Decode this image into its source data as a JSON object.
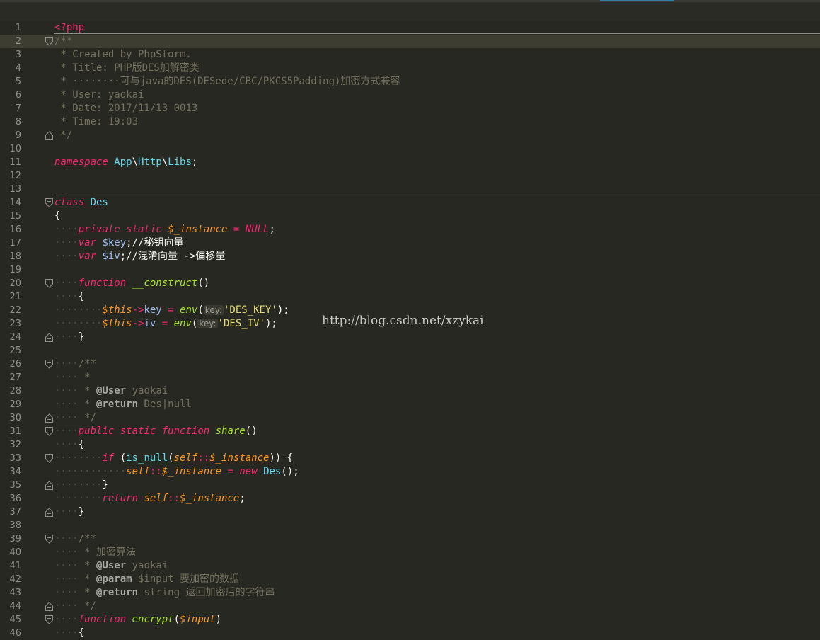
{
  "watermark": "http://blog.csdn.net/xzykai",
  "lines": [
    {
      "n": "1",
      "segs": [
        [
          "php-open",
          "<?php"
        ]
      ]
    },
    {
      "n": "2",
      "fold": "open",
      "current": true,
      "segs": [
        [
          "cmt",
          "/**"
        ]
      ]
    },
    {
      "n": "3",
      "segs": [
        [
          "cmt",
          " * Created by PhpStorm."
        ]
      ]
    },
    {
      "n": "4",
      "segs": [
        [
          "cmt",
          " * Title: PHP版DES加解密类"
        ]
      ]
    },
    {
      "n": "5",
      "segs": [
        [
          "cmt",
          " * ········可与java的DES(DESede/CBC/PKCS5Padding)加密方式兼容"
        ]
      ]
    },
    {
      "n": "6",
      "segs": [
        [
          "cmt",
          " * User: yaokai"
        ]
      ]
    },
    {
      "n": "7",
      "segs": [
        [
          "cmt",
          " * Date: 2017/11/13 0013"
        ]
      ]
    },
    {
      "n": "8",
      "segs": [
        [
          "cmt",
          " * Time: 19:03"
        ]
      ]
    },
    {
      "n": "9",
      "fold": "close",
      "segs": [
        [
          "cmt",
          " */"
        ]
      ]
    },
    {
      "n": "10",
      "segs": []
    },
    {
      "n": "11",
      "segs": [
        [
          "kw",
          "namespace"
        ],
        [
          "plain",
          " "
        ],
        [
          "cls",
          "App"
        ],
        [
          "plain",
          "\\"
        ],
        [
          "cls",
          "Http"
        ],
        [
          "plain",
          "\\"
        ],
        [
          "cls",
          "Libs"
        ],
        [
          "plain",
          ";"
        ]
      ]
    },
    {
      "n": "12",
      "segs": []
    },
    {
      "n": "13",
      "segs": []
    },
    {
      "n": "14",
      "fold": "open",
      "segs": [
        [
          "kw",
          "class"
        ],
        [
          "plain",
          " "
        ],
        [
          "cls",
          "Des"
        ]
      ]
    },
    {
      "n": "15",
      "segs": [
        [
          "plain",
          "{"
        ]
      ]
    },
    {
      "n": "16",
      "segs": [
        [
          "ws",
          "····"
        ],
        [
          "kw",
          "private"
        ],
        [
          "plain",
          " "
        ],
        [
          "kw",
          "static"
        ],
        [
          "plain",
          " "
        ],
        [
          "var",
          "$_instance"
        ],
        [
          "plain",
          " "
        ],
        [
          "kwn",
          "="
        ],
        [
          "plain",
          " "
        ],
        [
          "kw",
          "NULL"
        ],
        [
          "plain",
          ";"
        ]
      ]
    },
    {
      "n": "17",
      "segs": [
        [
          "ws",
          "····"
        ],
        [
          "kw",
          "var"
        ],
        [
          "plain",
          " "
        ],
        [
          "var2",
          "$key"
        ],
        [
          "plain",
          ";//秘钥向量"
        ]
      ]
    },
    {
      "n": "18",
      "segs": [
        [
          "ws",
          "····"
        ],
        [
          "kw",
          "var"
        ],
        [
          "plain",
          " "
        ],
        [
          "var2",
          "$iv"
        ],
        [
          "plain",
          ";//混淆向量 ->偏移量"
        ]
      ]
    },
    {
      "n": "19",
      "segs": []
    },
    {
      "n": "20",
      "fold": "open",
      "segs": [
        [
          "ws",
          "····"
        ],
        [
          "kw",
          "function"
        ],
        [
          "plain",
          " "
        ],
        [
          "fn",
          "__construct"
        ],
        [
          "plain",
          "()"
        ]
      ]
    },
    {
      "n": "21",
      "segs": [
        [
          "ws",
          "····"
        ],
        [
          "plain",
          "{"
        ]
      ]
    },
    {
      "n": "22",
      "segs": [
        [
          "ws",
          "········"
        ],
        [
          "var",
          "$this"
        ],
        [
          "kwn",
          "->"
        ],
        [
          "var2",
          "key"
        ],
        [
          "plain",
          " "
        ],
        [
          "kwn",
          "="
        ],
        [
          "plain",
          " "
        ],
        [
          "fn",
          "env"
        ],
        [
          "plain",
          "("
        ],
        [
          "hint",
          "key:"
        ],
        [
          "str",
          "'DES_KEY'"
        ],
        [
          "plain",
          ");"
        ]
      ]
    },
    {
      "n": "23",
      "segs": [
        [
          "ws",
          "········"
        ],
        [
          "var",
          "$this"
        ],
        [
          "kwn",
          "->"
        ],
        [
          "var2",
          "iv"
        ],
        [
          "plain",
          " "
        ],
        [
          "kwn",
          "="
        ],
        [
          "plain",
          " "
        ],
        [
          "fn",
          "env"
        ],
        [
          "plain",
          "("
        ],
        [
          "hint",
          "key:"
        ],
        [
          "str",
          "'DES_IV'"
        ],
        [
          "plain",
          ");"
        ]
      ]
    },
    {
      "n": "24",
      "fold": "close",
      "segs": [
        [
          "ws",
          "····"
        ],
        [
          "plain",
          "}"
        ]
      ]
    },
    {
      "n": "25",
      "segs": []
    },
    {
      "n": "26",
      "fold": "open",
      "segs": [
        [
          "ws",
          "····"
        ],
        [
          "cmt",
          "/**"
        ]
      ]
    },
    {
      "n": "27",
      "segs": [
        [
          "ws",
          "····"
        ],
        [
          "cmt",
          " *"
        ]
      ]
    },
    {
      "n": "28",
      "segs": [
        [
          "ws",
          "····"
        ],
        [
          "cmt",
          " * "
        ],
        [
          "tag",
          "@User"
        ],
        [
          "cmt",
          " yaokai"
        ]
      ]
    },
    {
      "n": "29",
      "segs": [
        [
          "ws",
          "····"
        ],
        [
          "cmt",
          " * "
        ],
        [
          "tag",
          "@return"
        ],
        [
          "cmt",
          " Des|null"
        ]
      ]
    },
    {
      "n": "30",
      "fold": "close",
      "segs": [
        [
          "ws",
          "····"
        ],
        [
          "cmt",
          " */"
        ]
      ]
    },
    {
      "n": "31",
      "fold": "open",
      "segs": [
        [
          "ws",
          "····"
        ],
        [
          "kw",
          "public"
        ],
        [
          "plain",
          " "
        ],
        [
          "kw",
          "static"
        ],
        [
          "plain",
          " "
        ],
        [
          "kw",
          "function"
        ],
        [
          "plain",
          " "
        ],
        [
          "fn",
          "share"
        ],
        [
          "plain",
          "()"
        ]
      ]
    },
    {
      "n": "32",
      "segs": [
        [
          "ws",
          "····"
        ],
        [
          "plain",
          "{"
        ]
      ]
    },
    {
      "n": "33",
      "fold": "open",
      "segs": [
        [
          "ws",
          "········"
        ],
        [
          "kw",
          "if"
        ],
        [
          "plain",
          " ("
        ],
        [
          "cls",
          "is_null"
        ],
        [
          "plain",
          "("
        ],
        [
          "var2i",
          "self"
        ],
        [
          "kwn",
          "::"
        ],
        [
          "var",
          "$_instance"
        ],
        [
          "plain",
          ")) {"
        ]
      ]
    },
    {
      "n": "34",
      "segs": [
        [
          "ws",
          "············"
        ],
        [
          "var2i",
          "self"
        ],
        [
          "kwn",
          "::"
        ],
        [
          "var",
          "$_instance"
        ],
        [
          "plain",
          " "
        ],
        [
          "kwn",
          "="
        ],
        [
          "plain",
          " "
        ],
        [
          "kw",
          "new"
        ],
        [
          "plain",
          " "
        ],
        [
          "cls",
          "Des"
        ],
        [
          "plain",
          "();"
        ]
      ]
    },
    {
      "n": "35",
      "fold": "close",
      "segs": [
        [
          "ws",
          "········"
        ],
        [
          "plain",
          "}"
        ]
      ]
    },
    {
      "n": "36",
      "segs": [
        [
          "ws",
          "········"
        ],
        [
          "kw",
          "return"
        ],
        [
          "plain",
          " "
        ],
        [
          "var2i",
          "self"
        ],
        [
          "kwn",
          "::"
        ],
        [
          "var",
          "$_instance"
        ],
        [
          "plain",
          ";"
        ]
      ]
    },
    {
      "n": "37",
      "fold": "close",
      "segs": [
        [
          "ws",
          "····"
        ],
        [
          "plain",
          "}"
        ]
      ]
    },
    {
      "n": "38",
      "segs": []
    },
    {
      "n": "39",
      "fold": "open",
      "segs": [
        [
          "ws",
          "····"
        ],
        [
          "cmt",
          "/**"
        ]
      ]
    },
    {
      "n": "40",
      "segs": [
        [
          "ws",
          "····"
        ],
        [
          "cmt",
          " * 加密算法"
        ]
      ]
    },
    {
      "n": "41",
      "segs": [
        [
          "ws",
          "····"
        ],
        [
          "cmt",
          " * "
        ],
        [
          "tag",
          "@User"
        ],
        [
          "cmt",
          " yaokai"
        ]
      ]
    },
    {
      "n": "42",
      "segs": [
        [
          "ws",
          "····"
        ],
        [
          "cmt",
          " * "
        ],
        [
          "tag",
          "@param"
        ],
        [
          "cmt",
          " $input 要加密的数据"
        ]
      ]
    },
    {
      "n": "43",
      "segs": [
        [
          "ws",
          "····"
        ],
        [
          "cmt",
          " * "
        ],
        [
          "tag",
          "@return"
        ],
        [
          "cmt",
          " string 返回加密后的字符串"
        ]
      ]
    },
    {
      "n": "44",
      "fold": "close",
      "segs": [
        [
          "ws",
          "····"
        ],
        [
          "cmt",
          " */"
        ]
      ]
    },
    {
      "n": "45",
      "fold": "open",
      "segs": [
        [
          "ws",
          "····"
        ],
        [
          "kw",
          "function"
        ],
        [
          "plain",
          " "
        ],
        [
          "fn",
          "encrypt"
        ],
        [
          "plain",
          "("
        ],
        [
          "var",
          "$input"
        ],
        [
          "plain",
          ")"
        ]
      ]
    },
    {
      "n": "46",
      "segs": [
        [
          "ws",
          "····"
        ],
        [
          "plain",
          "{"
        ]
      ]
    }
  ]
}
